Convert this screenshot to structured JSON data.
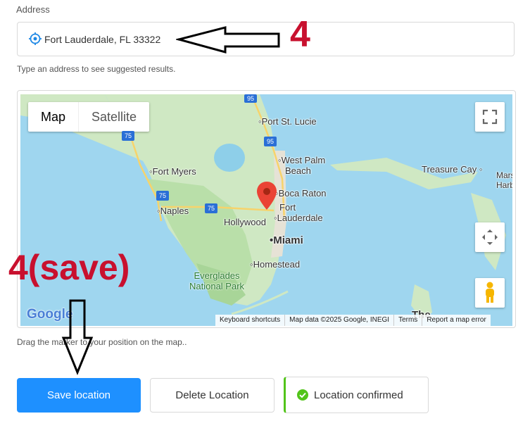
{
  "address": {
    "label": "Address",
    "value": "Fort Lauderdale, FL 33322",
    "hint": "Type an address to see suggested results."
  },
  "map": {
    "type_controls": {
      "map": "Map",
      "satellite": "Satellite"
    },
    "places": {
      "port_st_lucie": "Port St. Lucie",
      "west_palm_1": "West Palm",
      "west_palm_2": "Beach",
      "fort_myers": "Fort Myers",
      "boca_raton": "Boca Raton",
      "fort_1": "Fort",
      "fort_2": "Lauderdale",
      "naples": "Naples",
      "hollywood": "Hollywood",
      "miami": "Miami",
      "homestead": "Homestead",
      "everglades_1": "Everglades",
      "everglades_2": "National Park",
      "treasure_cay": "Treasure Cay",
      "mars_1": "Mars",
      "mars_2": "Harb",
      "the": "The"
    },
    "highways": {
      "h95_top": "95",
      "h95_mid": "95",
      "h75_a": "75",
      "h75_b": "75",
      "h75_c": "75"
    },
    "logo": "Google",
    "attribution": {
      "shortcuts": "Keyboard shortcuts",
      "data": "Map data ©2025 Google, INEGI",
      "terms": "Terms",
      "report": "Report a map error"
    },
    "drag_hint": "Drag the marker to your position on the map.."
  },
  "buttons": {
    "save": "Save location",
    "delete": "Delete Location"
  },
  "status": {
    "confirmed": "Location confirmed",
    "color": "#52c41a"
  },
  "annotations": {
    "step_address": "4",
    "step_save": "4(save)",
    "color": "#c8102e"
  }
}
